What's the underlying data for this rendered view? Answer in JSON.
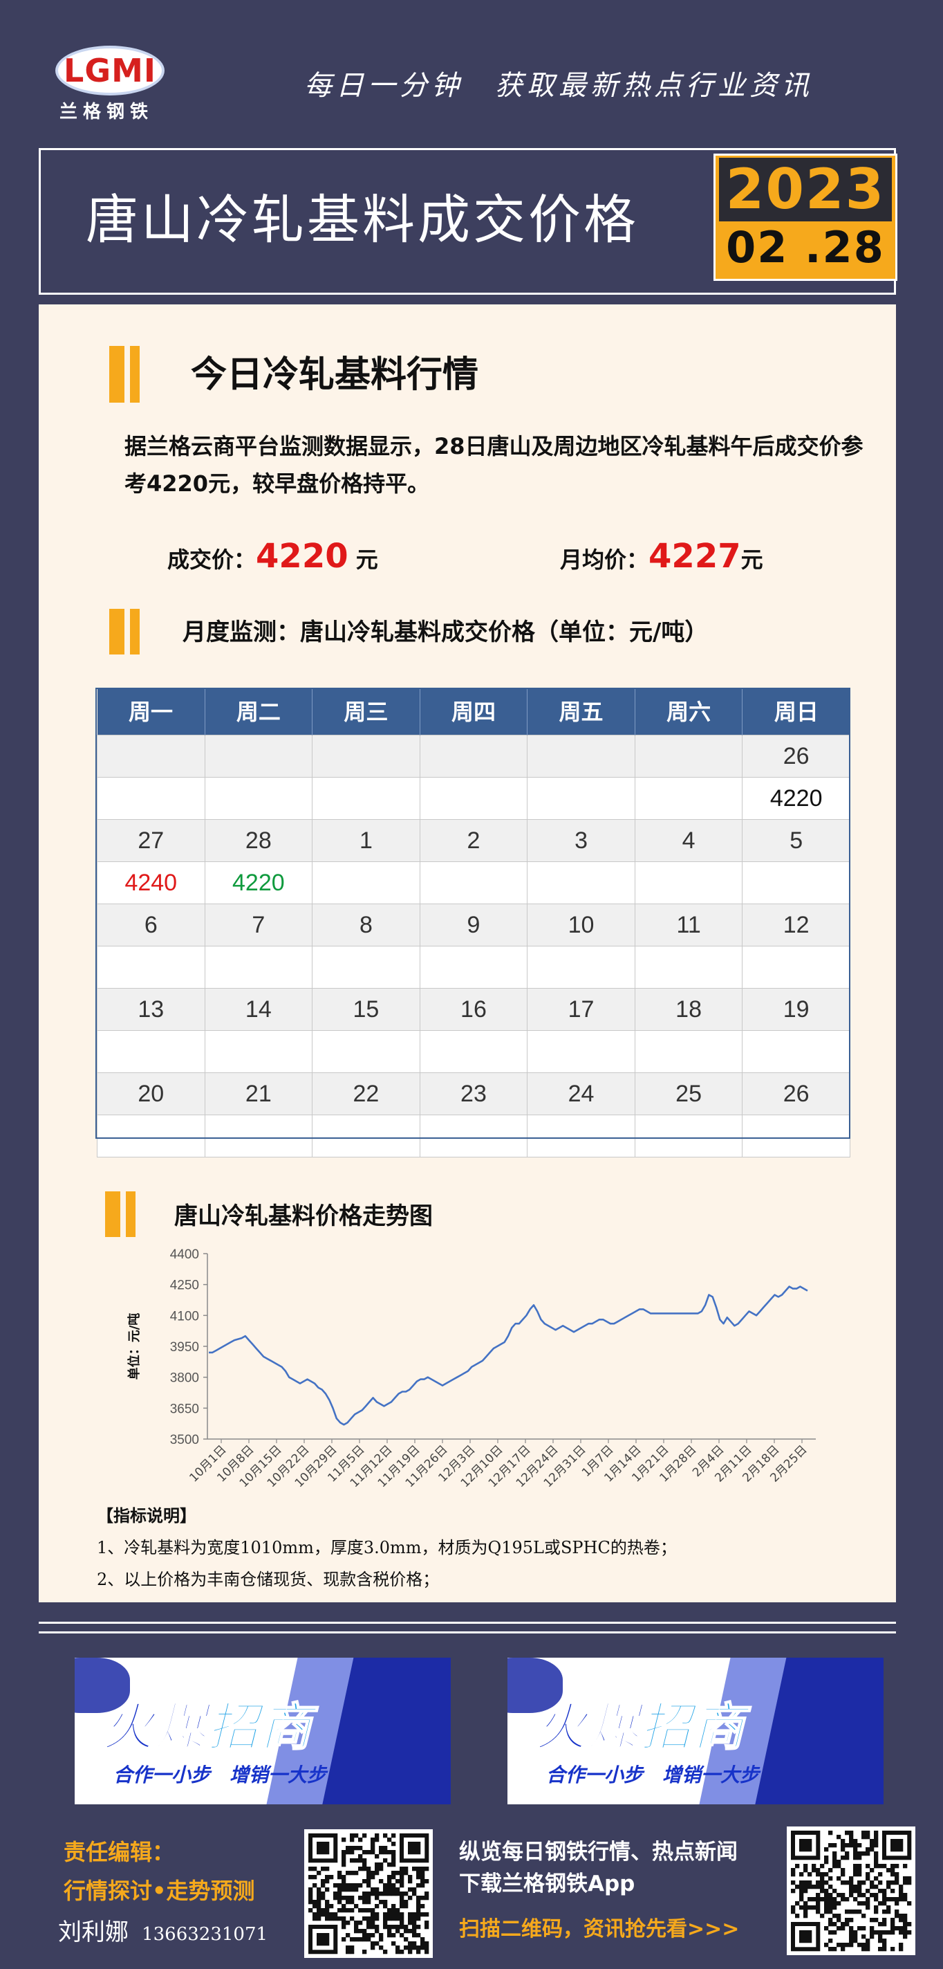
{
  "header": {
    "logo_text": "LGMI",
    "brand_name": "兰格钢铁",
    "slogan": "每日一分钟　获取最新热点行业资讯",
    "title": "唐山冷轧基料成交价格",
    "year": "2023",
    "date": "02 .28"
  },
  "today": {
    "heading": "今日冷轧基料行情",
    "description": "据兰格云商平台监测数据显示，28日唐山及周边地区冷轧基料午后成交价参考4220元，较早盘价格持平。",
    "deal_label": "成交价：",
    "deal_value": "4220",
    "deal_unit": " 元",
    "avg_label": "月均价：",
    "avg_value": "4227",
    "avg_unit": "元"
  },
  "monthly": {
    "heading": "月度监测：唐山冷轧基料成交价格（单位：元/吨）",
    "weekdays": [
      "周一",
      "周二",
      "周三",
      "周四",
      "周五",
      "周六",
      "周日"
    ],
    "weeks": [
      {
        "dates": [
          "",
          "",
          "",
          "",
          "",
          "",
          "26"
        ],
        "prices": [
          "",
          "",
          "",
          "",
          "",
          "",
          "4220"
        ]
      },
      {
        "dates": [
          "27",
          "28",
          "1",
          "2",
          "3",
          "4",
          "5"
        ],
        "prices": [
          "4240",
          "4220",
          "",
          "",
          "",
          "",
          ""
        ]
      },
      {
        "dates": [
          "6",
          "7",
          "8",
          "9",
          "10",
          "11",
          "12"
        ],
        "prices": [
          "",
          "",
          "",
          "",
          "",
          "",
          ""
        ]
      },
      {
        "dates": [
          "13",
          "14",
          "15",
          "16",
          "17",
          "18",
          "19"
        ],
        "prices": [
          "",
          "",
          "",
          "",
          "",
          "",
          ""
        ]
      },
      {
        "dates": [
          "20",
          "21",
          "22",
          "23",
          "24",
          "25",
          "26"
        ],
        "prices": [
          "",
          "",
          "",
          "",
          "",
          "",
          ""
        ]
      }
    ],
    "colors": {
      "up": "#e01919",
      "down": "#0f9a3d"
    }
  },
  "trend": {
    "heading": "唐山冷轧基料价格走势图"
  },
  "chart_data": {
    "type": "line",
    "title": "",
    "xlabel": "",
    "ylabel": "单位：元/吨",
    "ylim": [
      3500,
      4400
    ],
    "yticks": [
      3500,
      3650,
      3800,
      3950,
      4100,
      4250,
      4400
    ],
    "x_tick_labels": [
      "10月1日",
      "10月8日",
      "10月15日",
      "10月22日",
      "10月29日",
      "11月5日",
      "11月12日",
      "11月19日",
      "11月26日",
      "12月3日",
      "12月10日",
      "12月17日",
      "12月24日",
      "12月31日",
      "1月7日",
      "1月14日",
      "1月21日",
      "1月28日",
      "2月4日",
      "2月11日",
      "2月18日",
      "2月25日"
    ],
    "grid": false,
    "legend": "none",
    "color": "#4472c4",
    "values": [
      3920,
      3920,
      3930,
      3940,
      3950,
      3960,
      3970,
      3980,
      3985,
      3990,
      4000,
      3980,
      3960,
      3940,
      3920,
      3900,
      3890,
      3880,
      3870,
      3860,
      3850,
      3830,
      3800,
      3790,
      3780,
      3770,
      3780,
      3790,
      3780,
      3770,
      3750,
      3740,
      3720,
      3690,
      3650,
      3600,
      3580,
      3570,
      3580,
      3600,
      3620,
      3630,
      3640,
      3660,
      3680,
      3700,
      3680,
      3670,
      3660,
      3670,
      3680,
      3700,
      3720,
      3730,
      3730,
      3740,
      3760,
      3780,
      3790,
      3790,
      3800,
      3790,
      3780,
      3770,
      3760,
      3770,
      3780,
      3790,
      3800,
      3810,
      3820,
      3830,
      3850,
      3860,
      3870,
      3880,
      3900,
      3920,
      3940,
      3950,
      3960,
      3970,
      4000,
      4040,
      4060,
      4060,
      4080,
      4100,
      4130,
      4150,
      4120,
      4080,
      4060,
      4050,
      4040,
      4030,
      4040,
      4050,
      4040,
      4030,
      4020,
      4030,
      4040,
      4050,
      4060,
      4060,
      4070,
      4080,
      4080,
      4070,
      4060,
      4060,
      4070,
      4080,
      4090,
      4100,
      4110,
      4120,
      4130,
      4130,
      4120,
      4110,
      4110,
      4110,
      4110,
      4110,
      4110,
      4110,
      4110,
      4110,
      4110,
      4110,
      4110,
      4110,
      4110,
      4120,
      4150,
      4200,
      4190,
      4140,
      4080,
      4060,
      4090,
      4070,
      4050,
      4060,
      4080,
      4100,
      4120,
      4110,
      4100,
      4120,
      4140,
      4160,
      4180,
      4200,
      4190,
      4200,
      4220,
      4240,
      4230,
      4230,
      4240,
      4230,
      4220
    ]
  },
  "notes": {
    "title": "【指标说明】",
    "items": [
      "1、冷轧基料为宽度1010mm，厚度3.0mm，材质为Q195L或SPHC的热卷；",
      "2、以上价格为丰南仓储现货、现款含税价格；"
    ]
  },
  "banners": [
    {
      "big_a": "火爆",
      "big_b": "招商",
      "sub": "合作一小步　增销一大步"
    },
    {
      "big_a": "火爆",
      "big_b": "招商",
      "sub": "合作一小步　增销一大步"
    }
  ],
  "footer": {
    "editor_label": "责任编辑：",
    "tagline": "行情探讨•走势预测",
    "editor_name": "刘利娜",
    "phone": "13663231071",
    "promo_line1": "纵览每日钢铁行情、热点新闻",
    "promo_line2": "下载兰格钢铁App",
    "promo_line3": "扫描二维码，资讯抢先看>>>"
  }
}
